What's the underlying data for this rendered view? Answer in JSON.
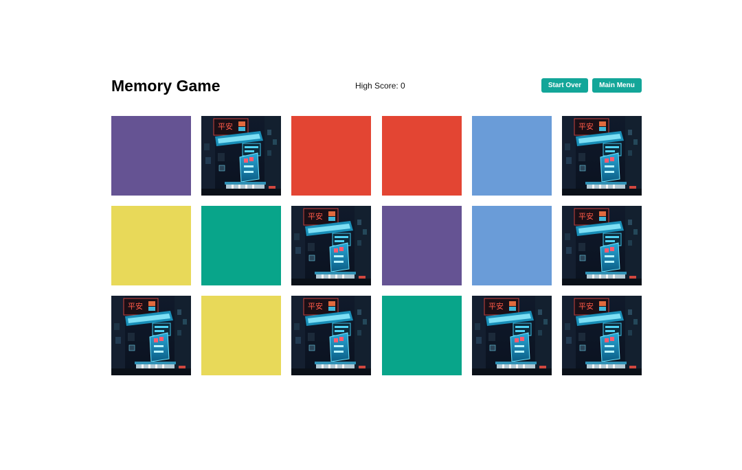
{
  "header": {
    "title": "Memory Game",
    "high_score_label": "High Score: 0",
    "start_over_label": "Start Over",
    "main_menu_label": "Main Menu"
  },
  "colors": {
    "purple": "#655393",
    "red": "#e34533",
    "blue": "#6a9cd8",
    "yellow": "#e8d959",
    "green": "#08a58a",
    "button": "#13a699"
  },
  "cards": [
    {
      "state": "face-up",
      "face": "purple"
    },
    {
      "state": "face-down",
      "face": "neon-city-back"
    },
    {
      "state": "face-up",
      "face": "red"
    },
    {
      "state": "face-up",
      "face": "red"
    },
    {
      "state": "face-up",
      "face": "blue"
    },
    {
      "state": "face-down",
      "face": "neon-city-back"
    },
    {
      "state": "face-up",
      "face": "yellow"
    },
    {
      "state": "face-up",
      "face": "green"
    },
    {
      "state": "face-down",
      "face": "neon-city-back"
    },
    {
      "state": "face-up",
      "face": "purple"
    },
    {
      "state": "face-up",
      "face": "blue"
    },
    {
      "state": "face-down",
      "face": "neon-city-back"
    },
    {
      "state": "face-down",
      "face": "neon-city-back"
    },
    {
      "state": "face-up",
      "face": "yellow"
    },
    {
      "state": "face-down",
      "face": "neon-city-back"
    },
    {
      "state": "face-up",
      "face": "green"
    },
    {
      "state": "face-down",
      "face": "neon-city-back"
    },
    {
      "state": "face-down",
      "face": "neon-city-back"
    }
  ]
}
